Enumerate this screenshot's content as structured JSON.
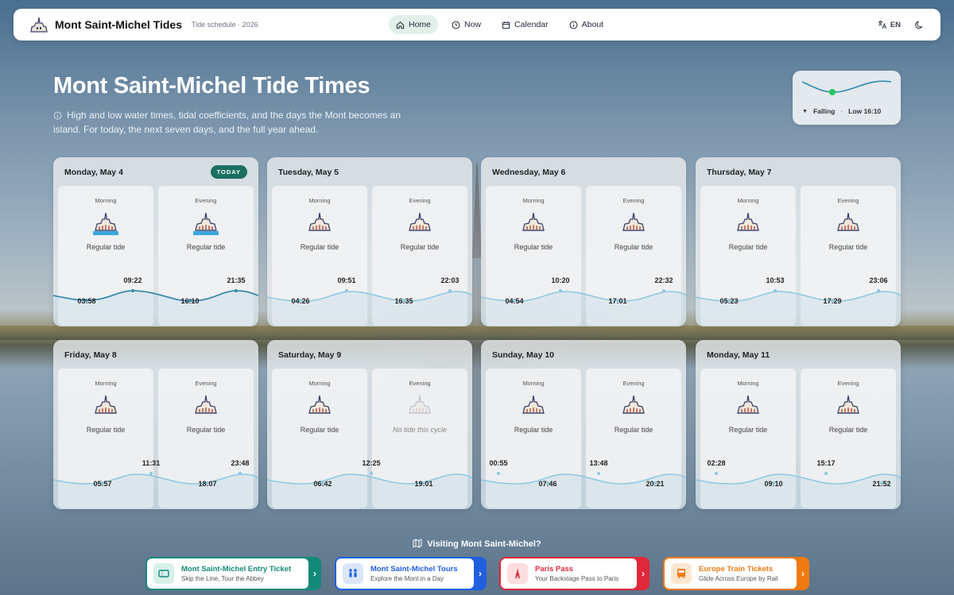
{
  "nav": {
    "brand_title": "Mont Saint-Michel Tides",
    "brand_sub": "Tide schedule · 2026",
    "menu": [
      {
        "label": "Home",
        "icon": "home-icon",
        "active": true
      },
      {
        "label": "Now",
        "icon": "clock-icon",
        "active": false
      },
      {
        "label": "Calendar",
        "icon": "calendar-icon",
        "active": false
      },
      {
        "label": "About",
        "icon": "info-icon",
        "active": false
      }
    ],
    "lang": "EN"
  },
  "hero": {
    "title": "Mont Saint-Michel Tide Times",
    "description": "High and low water times, tidal coefficients, and the days the Mont becomes an island. For today, the next seven days, and the full year ahead."
  },
  "status": {
    "trend": "Falling",
    "sep": "·",
    "next": "Low 16:10"
  },
  "days": [
    {
      "date": "Monday, May 4",
      "today": "TODAY",
      "morning": "Morning",
      "evening": "Evening",
      "m_desc": "Regular tide",
      "e_desc": "Regular tide",
      "times": [
        "03:58",
        "09:22",
        "16:10",
        "21:35"
      ]
    },
    {
      "date": "Tuesday, May 5",
      "morning": "Morning",
      "evening": "Evening",
      "m_desc": "Regular tide",
      "e_desc": "Regular tide",
      "times": [
        "04:26",
        "09:51",
        "16:35",
        "22:03"
      ]
    },
    {
      "date": "Wednesday, May 6",
      "morning": "Morning",
      "evening": "Evening",
      "m_desc": "Regular tide",
      "e_desc": "Regular tide",
      "times": [
        "04:54",
        "10:20",
        "17:01",
        "22:32"
      ]
    },
    {
      "date": "Thursday, May 7",
      "morning": "Morning",
      "evening": "Evening",
      "m_desc": "Regular tide",
      "e_desc": "Regular tide",
      "times": [
        "05:23",
        "10:53",
        "17:29",
        "23:06"
      ]
    },
    {
      "date": "Friday, May 8",
      "morning": "Morning",
      "evening": "Evening",
      "m_desc": "Regular tide",
      "e_desc": "Regular tide",
      "times": [
        "05:57",
        "11:31",
        "18:07",
        "23:48"
      ]
    },
    {
      "date": "Saturday, May 9",
      "morning": "Morning",
      "evening": "Evening",
      "m_desc": "Regular tide",
      "e_desc": "No tide this cycle",
      "times": [
        "06:42",
        "12:25",
        "19:01"
      ]
    },
    {
      "date": "Sunday, May 10",
      "morning": "Morning",
      "evening": "Evening",
      "m_desc": "Regular tide",
      "e_desc": "Regular tide",
      "times": [
        "00:55",
        "07:46",
        "13:48",
        "20:21"
      ]
    },
    {
      "date": "Monday, May 11",
      "morning": "Morning",
      "evening": "Evening",
      "m_desc": "Regular tide",
      "e_desc": "Regular tide",
      "times": [
        "02:28",
        "09:10",
        "15:17",
        "21:52"
      ]
    }
  ],
  "visit": {
    "title": "Visiting Mont Saint-Michel?",
    "promos": [
      {
        "title": "Mont Saint-Michel Entry Ticket",
        "sub": "Skip the Line, Tour the Abbey",
        "color": "#138a78",
        "icon": "ticket-icon"
      },
      {
        "title": "Mont Saint-Michel Tours",
        "sub": "Explore the Mont in a Day",
        "color": "#1f5fe0",
        "icon": "group-icon"
      },
      {
        "title": "Paris Pass",
        "sub": "Your Backstage Pass to Paris",
        "color": "#e0283a",
        "icon": "eiffel-tower-icon"
      },
      {
        "title": "Europe Train Tickets",
        "sub": "Glide Across Europe by Rail",
        "color": "#f07a10",
        "icon": "train-icon"
      }
    ]
  }
}
